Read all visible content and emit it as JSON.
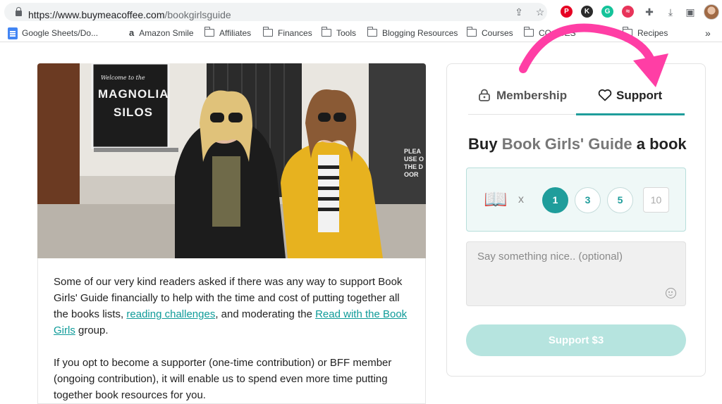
{
  "browser": {
    "url_host": "https://www.buymeacoffee.com",
    "url_path": "/bookgirlsguide",
    "bookmarks": [
      {
        "label": "Google Sheets/Do...",
        "icon": "google-docs-icon"
      },
      {
        "label": "Amazon Smile",
        "icon": "amazon-icon"
      },
      {
        "label": "Affiliates",
        "icon": "folder-icon"
      },
      {
        "label": "Finances",
        "icon": "folder-icon"
      },
      {
        "label": "Tools",
        "icon": "folder-icon"
      },
      {
        "label": "Blogging Resources",
        "icon": "folder-icon"
      },
      {
        "label": "Courses",
        "icon": "folder-icon"
      },
      {
        "label": "CO...CES",
        "icon": "folder-icon"
      },
      {
        "label": "Recipes",
        "icon": "folder-icon"
      }
    ],
    "overflow": "»",
    "extensions": [
      {
        "name": "pinterest-icon",
        "color": "#e60023",
        "glyph": "P"
      },
      {
        "name": "k-extension-icon",
        "color": "#2b2b2b",
        "glyph": "K"
      },
      {
        "name": "grammarly-icon",
        "color": "#15c39a",
        "glyph": "G"
      },
      {
        "name": "rakuten-icon",
        "color": "#e8345a",
        "glyph": "≈"
      }
    ]
  },
  "photo": {
    "sign_line1": "Welcome to the",
    "sign_line2": "MAGNOLIA",
    "sign_line3": "SILOS",
    "side_sign": "PLEA USE OTHE DOOR"
  },
  "post": {
    "p1_before": "Some of our very kind readers asked if there was any way to support Book Girls' Guide financially to help with the time and cost of putting together all the books lists, ",
    "p1_link1": "reading challenges",
    "p1_middle": ", and moderating the ",
    "p1_link2": "Read with the Book Girls",
    "p1_after": " group.",
    "p2": "If you opt to become a supporter (one-time contribution) or BFF member (ongoing contribution), it will enable us to spend even more time putting together book resources for you."
  },
  "support_panel": {
    "tabs": [
      {
        "label": "Membership",
        "icon": "lock-icon",
        "active": false
      },
      {
        "label": "Support",
        "icon": "heart-icon",
        "active": true
      }
    ],
    "heading_prefix": "Buy",
    "creator": "Book Girls' Guide",
    "heading_suffix": "a book",
    "item_emoji": "📖",
    "times": "x",
    "quantities": [
      "1",
      "3",
      "5"
    ],
    "selected_quantity": "1",
    "custom_quantity_placeholder": "10",
    "message_placeholder": "Say something nice.. (optional)",
    "button_label": "Support $3",
    "accent_color": "#1f9d9b",
    "annotation_arrow_color": "#ff3ea5"
  }
}
